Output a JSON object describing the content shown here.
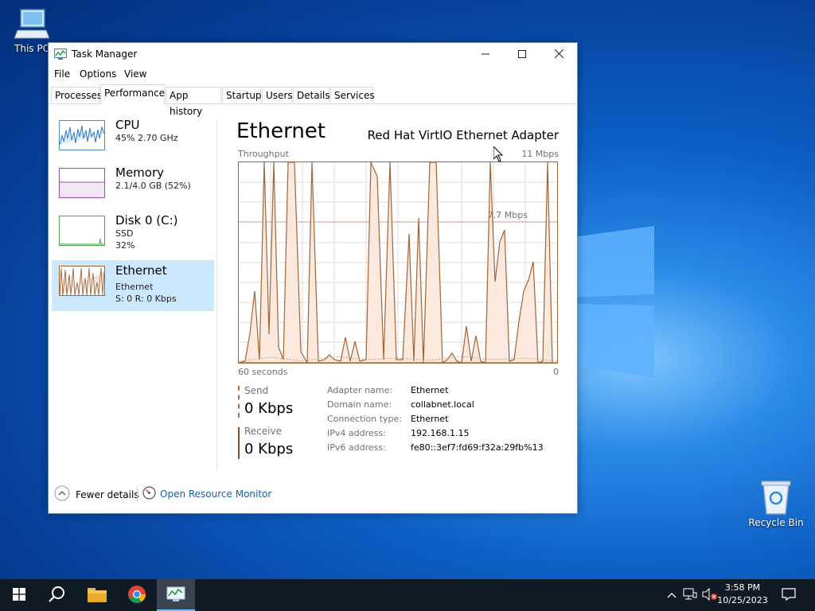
{
  "desktop": {
    "icons": [
      {
        "label": "This PC",
        "icon": "computer-icon"
      },
      {
        "label": "Recycle Bin",
        "icon": "recycle-bin-icon"
      }
    ]
  },
  "window": {
    "title": "Task Manager",
    "menu": [
      "File",
      "Options",
      "View"
    ],
    "tabs": [
      "Processes",
      "Performance",
      "App history",
      "Startup",
      "Users",
      "Details",
      "Services"
    ],
    "active_tab": "Performance"
  },
  "sidebar": {
    "items": [
      {
        "name": "CPU",
        "line1": "45%  2.70 GHz",
        "line2": ""
      },
      {
        "name": "Memory",
        "line1": "2.1/4.0 GB (52%)",
        "line2": ""
      },
      {
        "name": "Disk 0 (C:)",
        "line1": "SSD",
        "line2": "32%"
      },
      {
        "name": "Ethernet",
        "line1": "Ethernet",
        "line2": "S: 0  R: 0 Kbps"
      }
    ],
    "selected": "Ethernet"
  },
  "detail": {
    "title": "Ethernet",
    "adapter": "Red Hat VirtIO Ethernet Adapter",
    "graph_label": "Throughput",
    "graph_max": "11 Mbps",
    "graph_mid": "7.7 Mbps",
    "time_label": "60 seconds",
    "time_zero": "0",
    "send_label": "Send",
    "send_value": "0 Kbps",
    "receive_label": "Receive",
    "receive_value": "0 Kbps",
    "properties": [
      {
        "key": "Adapter name:",
        "value": "Ethernet"
      },
      {
        "key": "Domain name:",
        "value": "collabnet.local"
      },
      {
        "key": "Connection type:",
        "value": "Ethernet"
      },
      {
        "key": "IPv4 address:",
        "value": "192.168.1.15"
      },
      {
        "key": "IPv6 address:",
        "value": "fe80::3ef7:fd69:f32a:29fb%13"
      }
    ]
  },
  "footer": {
    "fewer_details": "Fewer details",
    "resource_monitor": "Open Resource Monitor"
  },
  "taskbar": {
    "time": "3:58 PM",
    "date": "10/25/2023"
  },
  "colors": {
    "graph_line": "#a0663a",
    "graph_fill": "#fbe9dd",
    "selection": "#cce8ff",
    "link": "#1a5ea8"
  }
}
